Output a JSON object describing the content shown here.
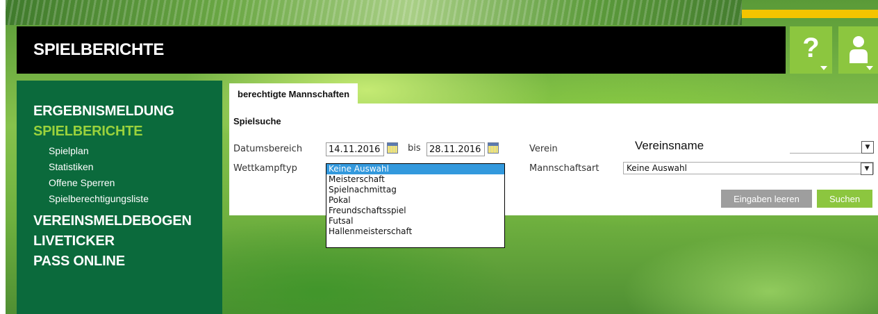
{
  "header": {
    "title": "SPIELBERICHTE",
    "help_symbol": "?"
  },
  "sidebar": {
    "items": [
      {
        "label": "ERGEBNISMELDUNG",
        "active": false
      },
      {
        "label": "SPIELBERICHTE",
        "active": true,
        "subitems": [
          "Spielplan",
          "Statistiken",
          "Offene Sperren",
          "Spielberechtigungsliste"
        ]
      },
      {
        "label": "VEREINSMELDEBOGEN",
        "active": false
      },
      {
        "label": "LIVETICKER",
        "active": false
      },
      {
        "label": "PASS ONLINE",
        "active": false
      }
    ]
  },
  "tabs": [
    {
      "label": "berechtigte Mannschaften"
    }
  ],
  "search": {
    "section_title": "Spielsuche",
    "date_range_label": "Datumsbereich",
    "date_from": "14.11.2016",
    "bis_label": "bis",
    "date_to": "28.11.2016",
    "wettkampftyp_label": "Wettkampftyp",
    "wettkampftyp_options": [
      "Keine Auswahl",
      "Meisterschaft",
      "Spielnachmittag",
      "Pokal",
      "Freundschaftsspiel",
      "Futsal",
      "Hallenmeisterschaft"
    ],
    "wettkampftyp_selected": "Keine Auswahl",
    "verein_label": "Verein",
    "verein_value": "Vereinsname",
    "mannschaftsart_label": "Mannschaftsart",
    "mannschaftsart_value": "Keine Auswahl",
    "clear_button": "Eingaben leeren",
    "search_button": "Suchen"
  },
  "colors": {
    "accent_green": "#8cc63f",
    "sidebar_bg": "#0b6a3c",
    "active_nav": "#9bd23c",
    "header_bg": "#000000",
    "yellow_bar": "#f5c400",
    "selected_option": "#3399dd"
  }
}
